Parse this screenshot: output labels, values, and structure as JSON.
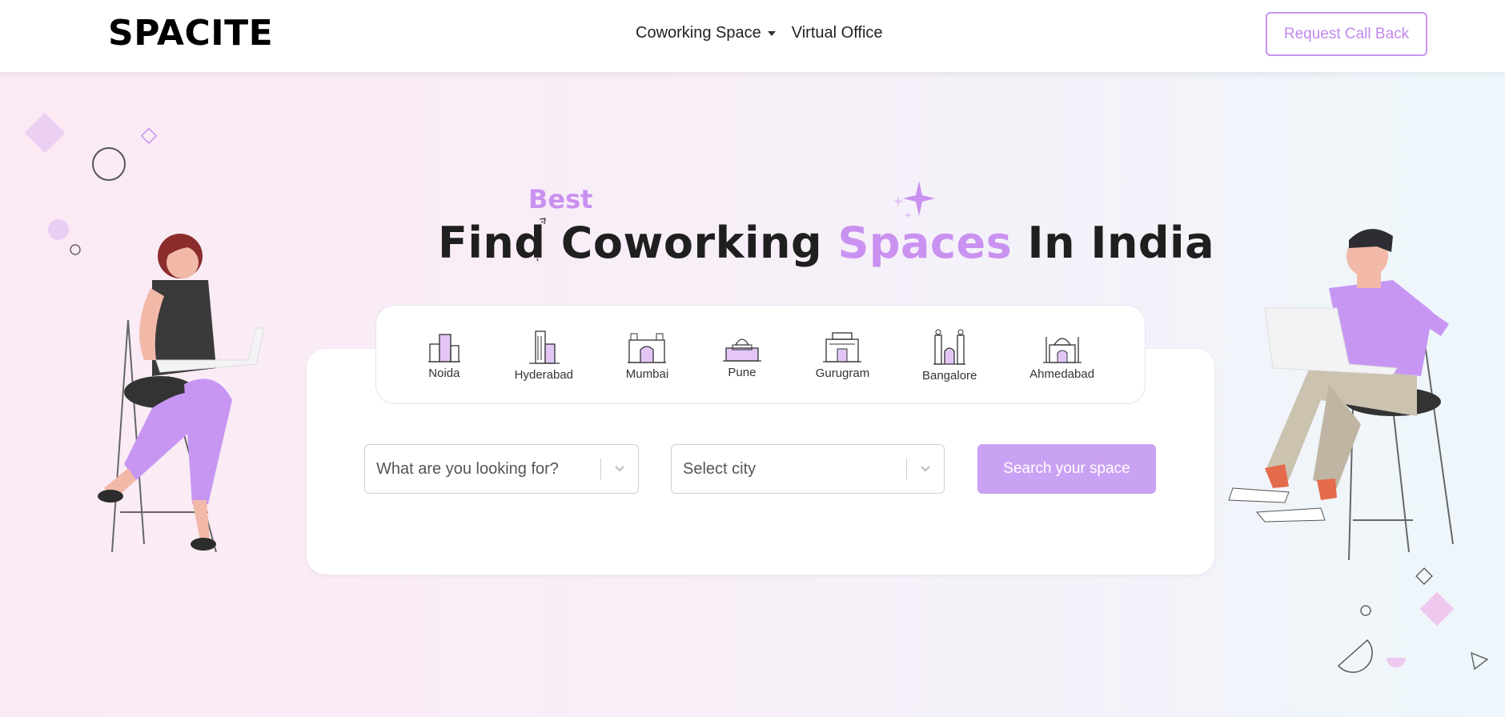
{
  "header": {
    "logo": "SPACITE",
    "nav": [
      {
        "label": "Coworking Space",
        "dropdown": true
      },
      {
        "label": "Virtual Office",
        "dropdown": false
      }
    ],
    "cta_label": "Request Call Back"
  },
  "hero": {
    "best": "Best",
    "title_part1": "Find Coworking ",
    "title_accent": "Spaces",
    "title_part2": " In India"
  },
  "cities": [
    {
      "label": "Noida",
      "icon": "noida-building-icon"
    },
    {
      "label": "Hyderabad",
      "icon": "hyderabad-tower-icon"
    },
    {
      "label": "Mumbai",
      "icon": "mumbai-gateway-icon"
    },
    {
      "label": "Pune",
      "icon": "pune-monument-icon"
    },
    {
      "label": "Gurugram",
      "icon": "gurugram-building-icon"
    },
    {
      "label": "Bangalore",
      "icon": "bangalore-palace-icon"
    },
    {
      "label": "Ahmedabad",
      "icon": "ahmedabad-mosque-icon"
    }
  ],
  "search": {
    "type_placeholder": "What are you looking for?",
    "city_placeholder": "Select city",
    "button_label": "Search your space"
  },
  "colors": {
    "accent": "#c991f0",
    "button": "#caa2f4"
  }
}
